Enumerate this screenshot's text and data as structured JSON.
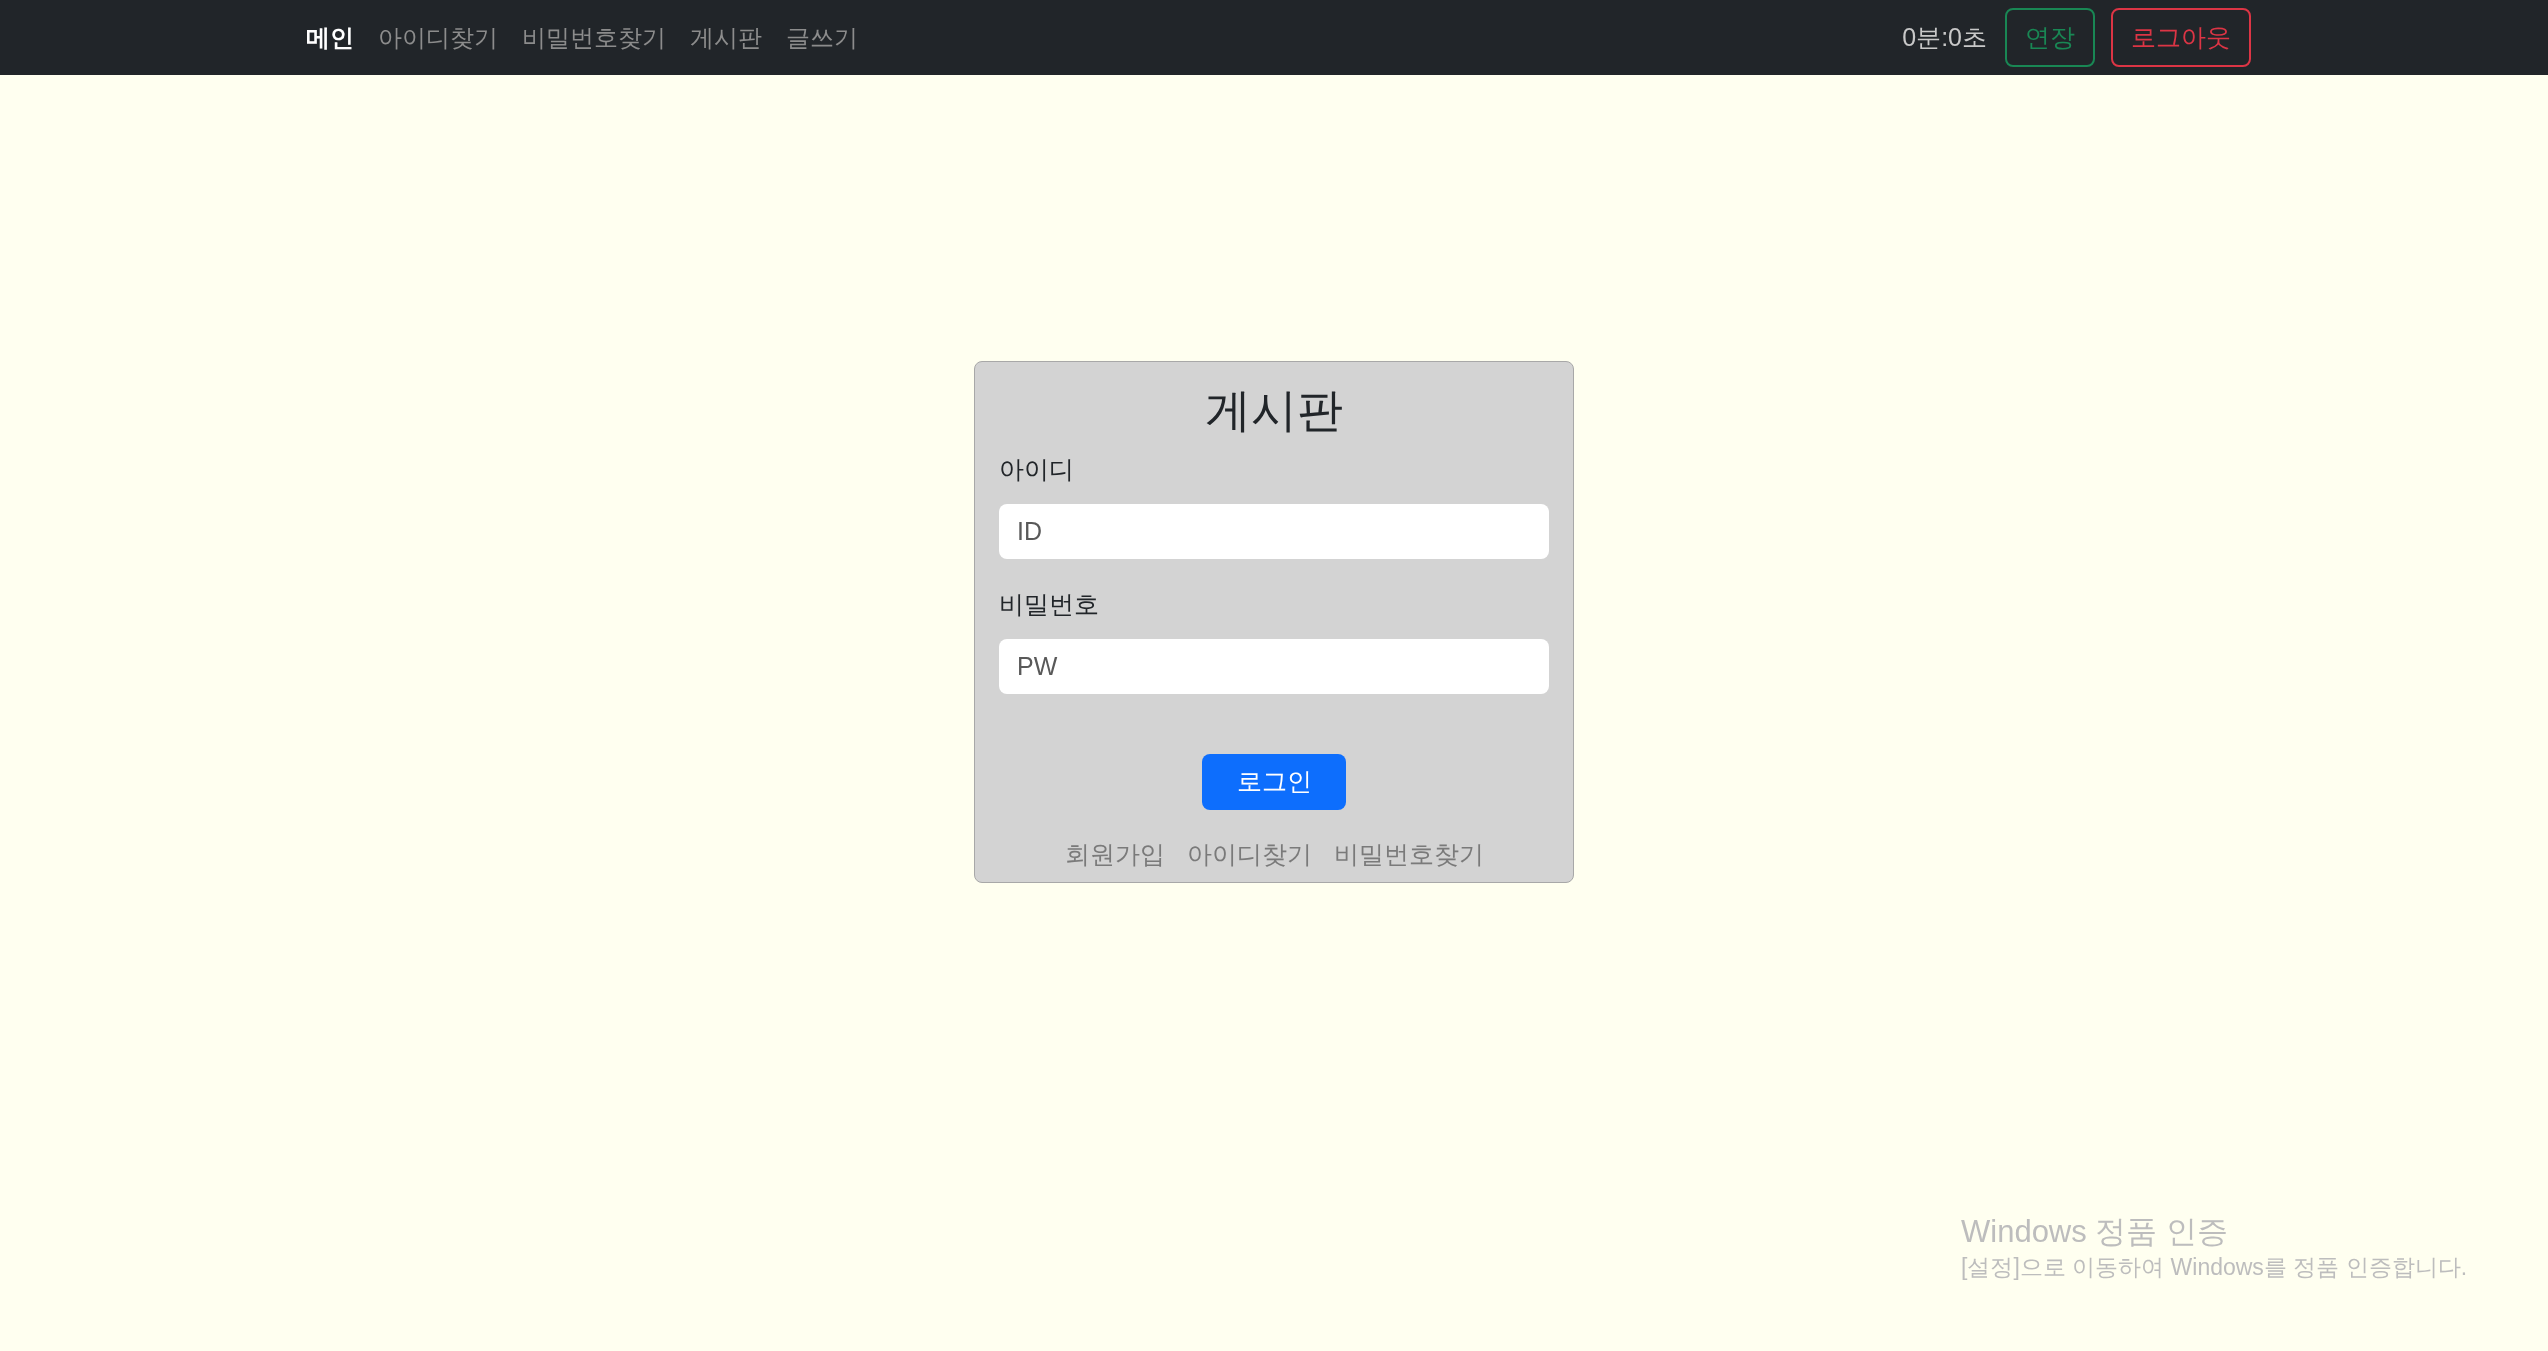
{
  "navbar": {
    "items": [
      {
        "label": "메인",
        "selected": true
      },
      {
        "label": "아이디찾기",
        "selected": false
      },
      {
        "label": "비밀번호찾기",
        "selected": false
      },
      {
        "label": "게시판",
        "selected": false
      },
      {
        "label": "글쓰기",
        "selected": false
      }
    ],
    "timer": "0분:0초",
    "buttons": [
      {
        "label": "연장",
        "kind": "success"
      },
      {
        "label": "로그아웃",
        "kind": "danger"
      }
    ]
  },
  "login": {
    "title": "게시판",
    "fields": [
      {
        "label": "아이디",
        "placeholder": "ID"
      },
      {
        "label": "비밀번호",
        "placeholder": "PW"
      }
    ],
    "submit": "로그인",
    "links": [
      "회원가입",
      "아이디찾기",
      "비밀번호찾기"
    ]
  },
  "activation_notice": {
    "title": "Windows 정품 인증",
    "text": "[설정]으로 이동하여 Windows를 정품 인증합니다."
  }
}
